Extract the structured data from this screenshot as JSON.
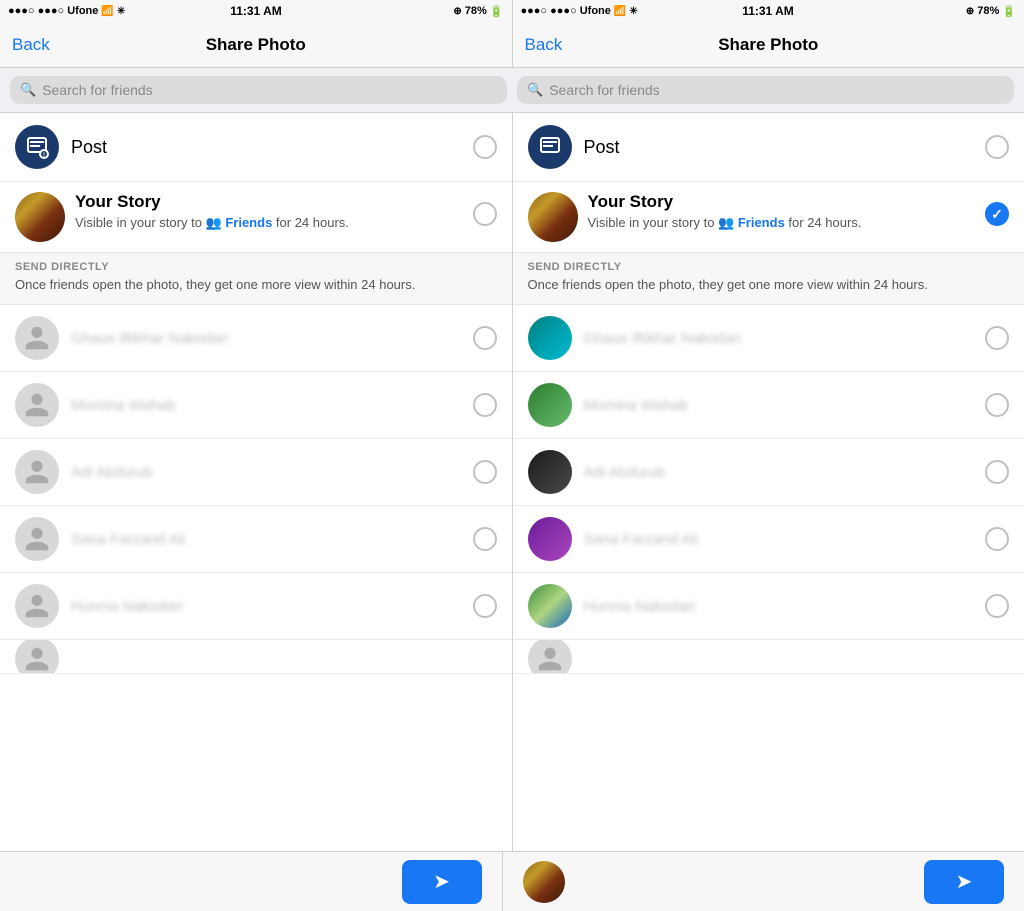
{
  "status": {
    "left": {
      "carrier": "●●●○ Ufone",
      "wifi": "WiFi",
      "time": "11:31 AM",
      "battery": "78%"
    },
    "right": {
      "carrier": "●●●○ Ufone",
      "wifi": "WiFi",
      "time": "11:31 AM",
      "battery": "78%"
    }
  },
  "nav": {
    "back_label": "Back",
    "title": "Share Photo"
  },
  "search": {
    "placeholder": "Search for friends"
  },
  "post": {
    "label": "Post"
  },
  "story": {
    "title": "Your Story",
    "subtitle_prefix": "Visible in your story to",
    "friends_label": "Friends",
    "subtitle_suffix": "for 24 hours."
  },
  "send_directly": {
    "title": "SEND DIRECTLY",
    "description": "Once friends open the photo, they get one more view within 24 hours."
  },
  "friends": [
    {
      "name": "Ghaus Iftikhar Nakodari"
    },
    {
      "name": "Momina Wahab"
    },
    {
      "name": "Adi Abdurub"
    },
    {
      "name": "Sana Farzand Ali"
    },
    {
      "name": "Hunnia Nakodari"
    }
  ],
  "left_panel": {
    "story_selected": false,
    "post_selected": false
  },
  "right_panel": {
    "story_selected": true,
    "post_selected": false
  }
}
